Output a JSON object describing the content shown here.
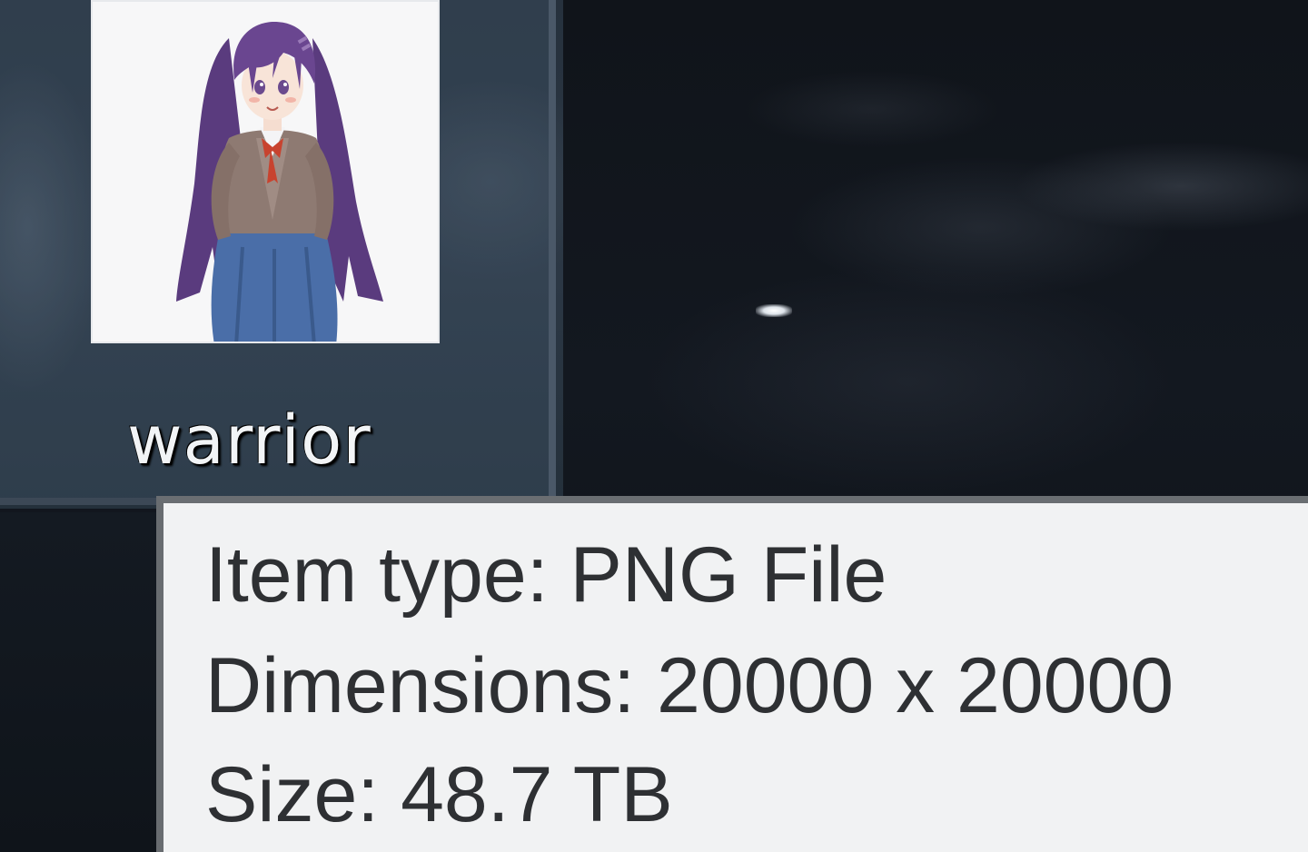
{
  "file": {
    "name": "warrior"
  },
  "tooltip": {
    "item_type": "Item type: PNG File",
    "dimensions": "Dimensions: 20000 x 20000",
    "size": "Size: 48.7 TB"
  },
  "colors": {
    "desktop_background": "#10141a",
    "selection_background": "#2b3744",
    "tooltip_background": "#f1f2f3",
    "tooltip_text": "#2e3033",
    "label_text": "#f2f4f6"
  }
}
